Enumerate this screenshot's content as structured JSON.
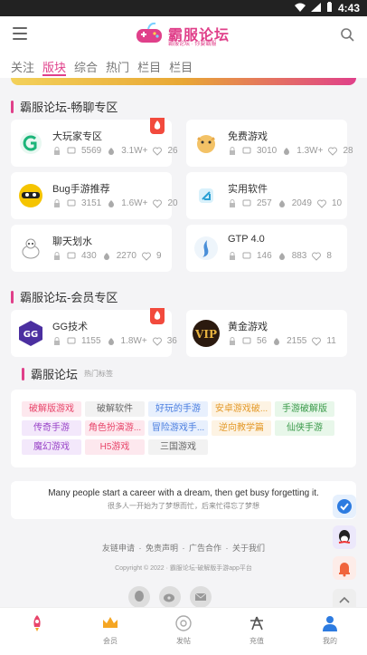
{
  "status": {
    "time": "4:43"
  },
  "header": {
    "logo_text": "霸服论坛",
    "logo_sub": "霸服论坛 · 你要霸服"
  },
  "tabs": [
    "关注",
    "版块",
    "综合",
    "热门",
    "栏目",
    "栏目"
  ],
  "sections": [
    {
      "title": "霸服论坛-畅聊专区",
      "cards": [
        {
          "name": "大玩家专区",
          "posts": "5569",
          "views": "3.1W+",
          "likes": "26",
          "hot": true
        },
        {
          "name": "免费游戏",
          "posts": "3010",
          "views": "1.3W+",
          "likes": "28",
          "hot": false
        },
        {
          "name": "Bug手游推荐",
          "posts": "3151",
          "views": "1.6W+",
          "likes": "20",
          "hot": false
        },
        {
          "name": "实用软件",
          "posts": "257",
          "views": "2049",
          "likes": "10",
          "hot": false
        },
        {
          "name": "聊天划水",
          "posts": "430",
          "views": "2270",
          "likes": "9",
          "hot": false
        },
        {
          "name": "GTP 4.0",
          "posts": "146",
          "views": "883",
          "likes": "8",
          "hot": false
        }
      ]
    },
    {
      "title": "霸服论坛-会员专区",
      "cards": [
        {
          "name": "GG技术",
          "posts": "1155",
          "views": "1.8W+",
          "likes": "36",
          "hot": true
        },
        {
          "name": "黄金游戏",
          "posts": "56",
          "views": "2155",
          "likes": "11",
          "hot": false
        }
      ]
    }
  ],
  "tags_section": {
    "title": "霸服论坛",
    "subtitle": "热门标签",
    "tags": [
      "破解版游戏",
      "破解软件",
      "好玩的手游",
      "安卓游戏破...",
      "手游破解版",
      "传奇手游",
      "角色扮演游...",
      "冒险游戏手...",
      "逆向教学篇",
      "仙侠手游",
      "魔幻游戏",
      "H5游戏",
      "三国游戏"
    ]
  },
  "quote": {
    "en": "Many people start a career with a dream, then get busy forgetting it.",
    "cn": "很多人一开始为了梦想而忙，后来忙得忘了梦想"
  },
  "footer": {
    "links": [
      "友链申请",
      "免责声明",
      "广告合作",
      "关于我们"
    ],
    "copyright": "Copyright © 2022 · 霸服论坛-破解版手游app平台"
  },
  "bottom_nav": [
    "",
    "会员",
    "发帖",
    "充值",
    "我的"
  ],
  "colors": {
    "accent": "#e0408a",
    "hot": "#f24a3d"
  }
}
